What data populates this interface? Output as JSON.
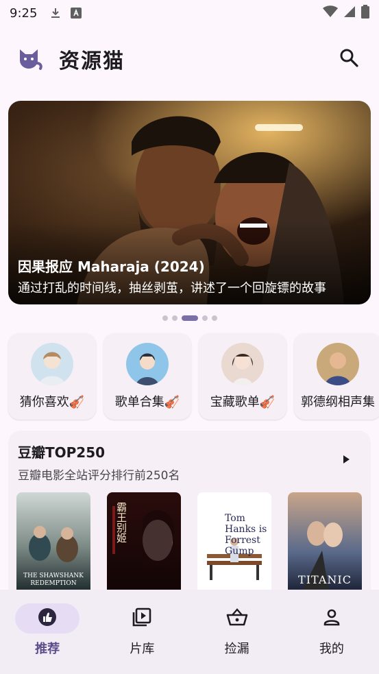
{
  "status_bar": {
    "time": "9:25",
    "icons": [
      "download-icon",
      "font-icon",
      "wifi-icon",
      "signal-icon",
      "battery-icon"
    ]
  },
  "app_bar": {
    "title": "资源猫",
    "logo_icon": "cat-icon",
    "search_icon": "search-icon"
  },
  "banner": {
    "title": "因果报应 Maharaja (2024)",
    "subtitle": "通过打乱的时间线，抽丝剥茧，讲述了一个回旋镖的故事",
    "page_count": 5,
    "active_page": 2
  },
  "categories": [
    {
      "label": "猜你喜欢🎻"
    },
    {
      "label": "歌单合集🎻"
    },
    {
      "label": "宝藏歌单🎻"
    },
    {
      "label": "郭德纲相声集"
    }
  ],
  "douban": {
    "title": "豆瓣TOP250",
    "subtitle": "豆瓣电影全站评分排行前250名",
    "posters": [
      {
        "text": "THE SHAWSHANK REDEMPTION"
      },
      {
        "text": "霸王别姬"
      },
      {
        "text": "Tom Hanks is Forrest Gump"
      },
      {
        "text": "TITANIC"
      }
    ]
  },
  "bottom_nav": [
    {
      "label": "推荐",
      "icon": "thumb-up-icon",
      "active": true
    },
    {
      "label": "片库",
      "icon": "video-library-icon",
      "active": false
    },
    {
      "label": "捡漏",
      "icon": "basket-icon",
      "active": false
    },
    {
      "label": "我的",
      "icon": "person-icon",
      "active": false
    }
  ],
  "colors": {
    "background": "#fdf7fd",
    "accent": "#7b6fa8",
    "nav_active_pill": "#e6ddf4",
    "card": "#f6f0f6"
  }
}
